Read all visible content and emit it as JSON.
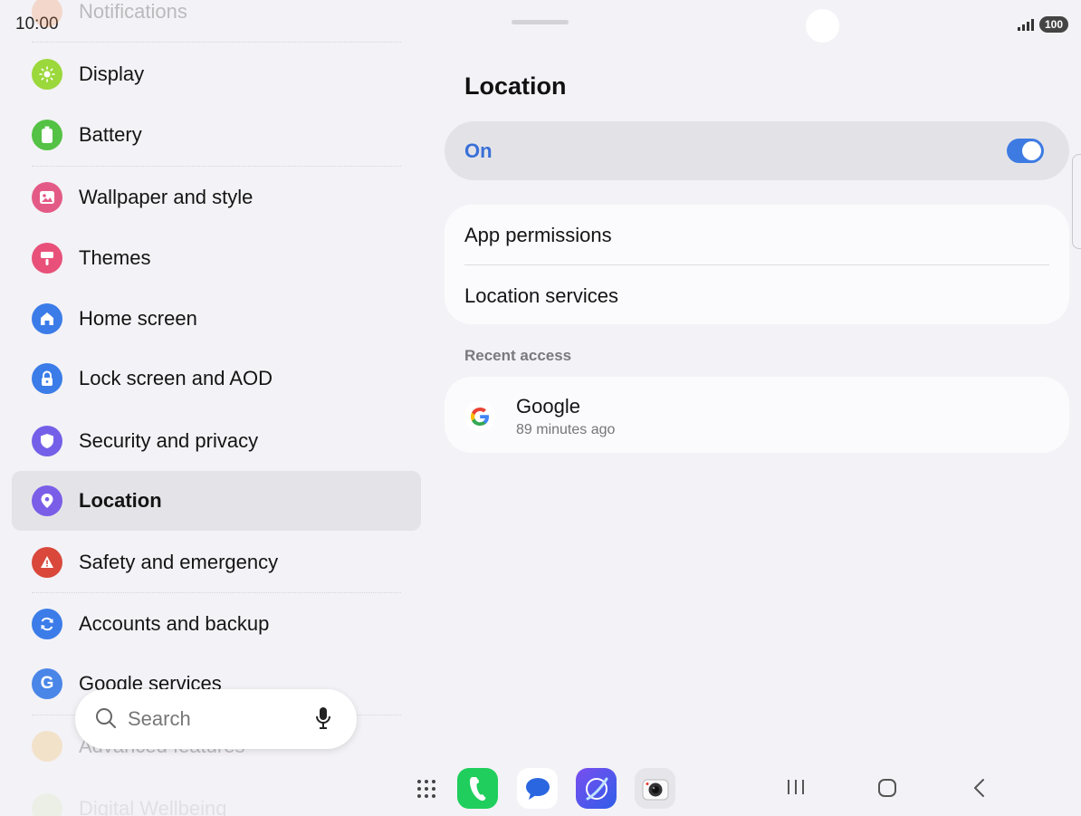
{
  "status_bar": {
    "time": "10:00",
    "battery": "100"
  },
  "settings_list": {
    "items": [
      {
        "label": "Notifications",
        "icon": "bell-icon",
        "color": "#f08a4b"
      },
      {
        "label": "Display",
        "icon": "sun-icon",
        "color": "#9bd83b"
      },
      {
        "label": "Battery",
        "icon": "battery-icon",
        "color": "#54c244"
      },
      {
        "label": "Wallpaper and style",
        "icon": "image-icon",
        "color": "#e45a86"
      },
      {
        "label": "Themes",
        "icon": "brush-icon",
        "color": "#e8507a"
      },
      {
        "label": "Home screen",
        "icon": "home-icon",
        "color": "#3b7ce8"
      },
      {
        "label": "Lock screen and AOD",
        "icon": "lock-icon",
        "color": "#3b7ce8"
      },
      {
        "label": "Security and privacy",
        "icon": "shield-icon",
        "color": "#7460e8"
      },
      {
        "label": "Location",
        "icon": "location-pin-icon",
        "color": "#7a5ee8",
        "selected": true
      },
      {
        "label": "Safety and emergency",
        "icon": "alert-icon",
        "color": "#d9483b"
      },
      {
        "label": "Accounts and backup",
        "icon": "sync-icon",
        "color": "#3b7ce8"
      },
      {
        "label": "Google services",
        "icon": "google-g-icon",
        "color": "#4a86e8"
      },
      {
        "label": "Advanced features",
        "icon": "gear-flower-icon",
        "color": "#f0b44a"
      },
      {
        "label": "Digital Wellbeing",
        "icon": "wellbeing-icon",
        "color": "#9bd83b"
      }
    ]
  },
  "search": {
    "placeholder": "Search"
  },
  "location_page": {
    "title": "Location",
    "master_toggle": {
      "label": "On",
      "state": true
    },
    "options": [
      "App permissions",
      "Location services"
    ],
    "recent_access_label": "Recent access",
    "recent": [
      {
        "app": "Google",
        "time": "89 minutes ago"
      }
    ]
  },
  "dock": {
    "apps": [
      {
        "name": "apps-grid-icon"
      },
      {
        "name": "phone-icon",
        "color": "#1fce5c"
      },
      {
        "name": "messages-icon",
        "color": "#2a66e0"
      },
      {
        "name": "internet-icon",
        "color": "#5a4ee8"
      },
      {
        "name": "camera-icon",
        "color": "#e6e6ea"
      }
    ]
  },
  "nav": {
    "buttons": [
      "recents-button",
      "home-button",
      "back-button"
    ]
  }
}
